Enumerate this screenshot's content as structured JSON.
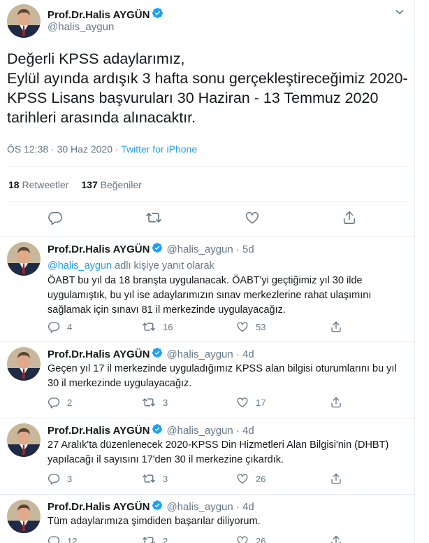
{
  "main_tweet": {
    "name": "Prof.Dr.Halis AYGÜN",
    "handle": "@halis_aygun",
    "text": "Değerli KPSS adaylarımız,\nEylül ayında ardışık 3 hafta sonu gerçekleştireceğimiz 2020-KPSS Lisans başvuruları 30 Haziran - 13 Temmuz 2020 tarihleri arasında alınacaktır.",
    "time": "ÖS 12:38 · 30 Haz 2020 · ",
    "source": "Twitter for iPhone",
    "retweets_count": "18",
    "retweets_label": "Retweetler",
    "likes_count": "137",
    "likes_label": "Beğeniler"
  },
  "replies": [
    {
      "name": "Prof.Dr.Halis AYGÜN",
      "handle": "@halis_aygun · 5d",
      "replying_mention": "@halis_aygun",
      "replying_suffix": " adlı kişiye yanıt olarak",
      "text": "ÖABT bu yıl da 18 branşta uygulanacak. ÖABT'yi geçtiğimiz yıl 30 ilde uygulamıştık, bu yıl ise adaylarımızın sınav merkezlerine rahat ulaşımını sağlamak için sınavı 81 il merkezinde uygulayacağız.",
      "reply_count": "4",
      "retweet_count": "16",
      "like_count": "53"
    },
    {
      "name": "Prof.Dr.Halis AYGÜN",
      "handle": "@halis_aygun · 4d",
      "text": "Geçen yıl 17 il merkezinde uyguladığımız KPSS alan bilgisi oturumlarını bu yıl 30 il merkezinde uygulayacağız.",
      "reply_count": "2",
      "retweet_count": "3",
      "like_count": "17"
    },
    {
      "name": "Prof.Dr.Halis AYGÜN",
      "handle": "@halis_aygun · 4d",
      "text": "27 Aralık'ta düzenlenecek 2020-KPSS Din Hizmetleri Alan Bilgisi'nin (DHBT) yapılacağı il sayısını 17'den 30 il merkezine çıkardık.",
      "reply_count": "3",
      "retweet_count": "3",
      "like_count": "26"
    },
    {
      "name": "Prof.Dr.Halis AYGÜN",
      "handle": "@halis_aygun · 4d",
      "text": "Tüm adaylarımıza şimdiden başarılar diliyorum.",
      "reply_count": "12",
      "retweet_count": "2",
      "like_count": "26"
    }
  ],
  "colors": {
    "accent": "#1da1f2",
    "muted": "#657786",
    "text": "#14171a",
    "divider": "#e6ecf0"
  },
  "icons": [
    "verified-badge-icon",
    "chevron-down-icon",
    "reply-icon",
    "retweet-icon",
    "like-icon",
    "share-icon"
  ]
}
